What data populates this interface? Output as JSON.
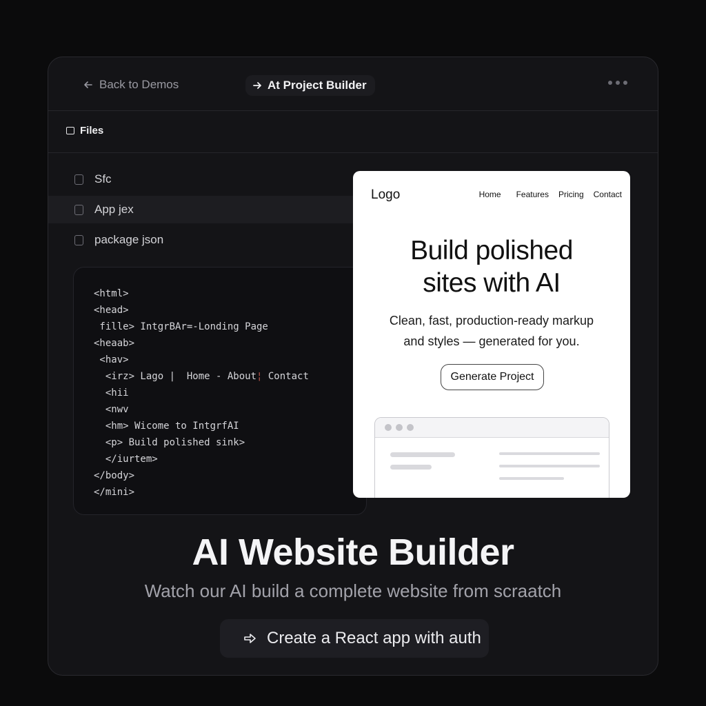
{
  "topbar": {
    "back_label": "Back to Demos",
    "title": "At Project Builder",
    "more_icon": "more-horizontal-icon"
  },
  "files": {
    "header": "Files",
    "items": [
      {
        "name": "Sfc"
      },
      {
        "name": "App jex",
        "active": true
      },
      {
        "name": "package json"
      }
    ]
  },
  "code": {
    "lines": [
      "<html>",
      "<head>",
      " fille> IntgrBAr=-Londing Page",
      "<heaab>",
      " <hav>",
      "  <irz> Lago |  Home - About",
      "  <hii",
      "  <nwv",
      "  <hm> Wicome to IntgrfAI",
      "  <p> Build polished sink>",
      "  </iurtem>",
      "</body>",
      "</mini>"
    ],
    "line5_separator": "¦",
    "line5_tail": " Contact"
  },
  "preview": {
    "logo": "Logo",
    "nav": [
      "Home",
      "Features",
      "Pricing",
      "Contact"
    ],
    "headline_line1": "Build polished",
    "headline_line2": "sites with AI",
    "sub_line1": "Clean, fast, production-ready markup",
    "sub_line2": "and styles — generated for you.",
    "button": "Generate Project"
  },
  "hero": {
    "title": "AI Website Builder",
    "subtitle": "Watch our AI build a complete website from scraatch",
    "cta": "Create a React app with auth"
  },
  "colors": {
    "background": "#0b0b0c",
    "window": "#141417",
    "accent_code": "#c0584b"
  }
}
